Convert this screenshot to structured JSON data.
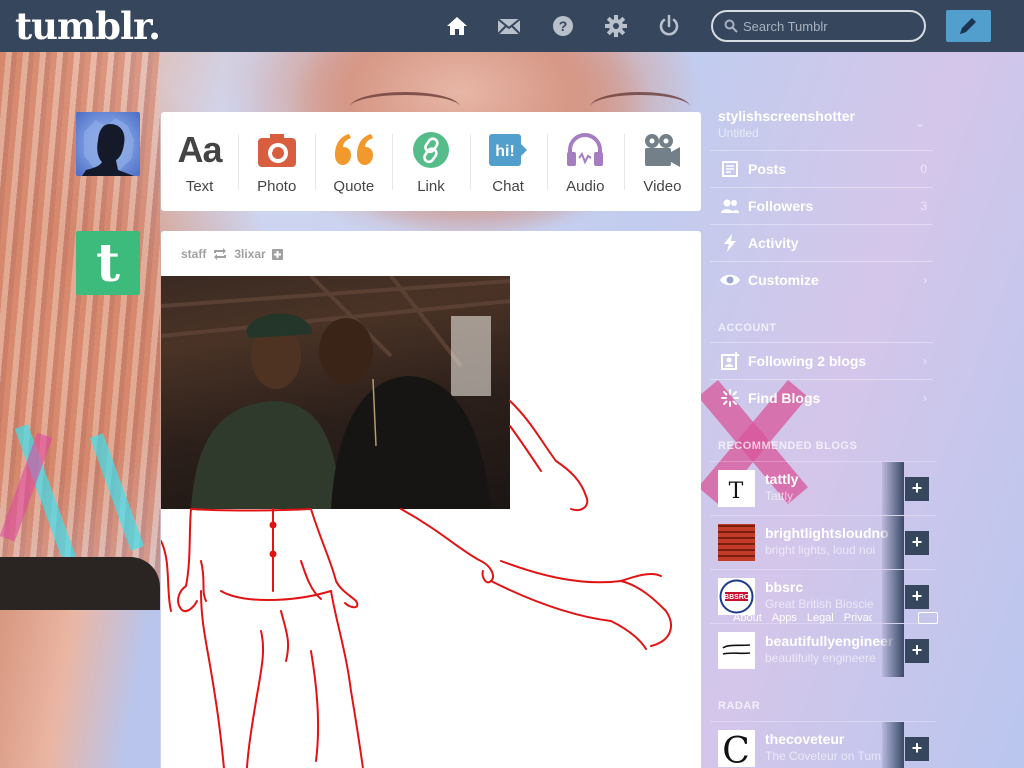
{
  "header": {
    "logo": "tumblr.",
    "search_placeholder": "Search Tumblr",
    "nav": [
      "home-icon",
      "mail-icon",
      "help-icon",
      "gear-icon",
      "power-icon"
    ],
    "compose_icon": "pencil-icon"
  },
  "post_types": [
    {
      "label": "Text",
      "icon": "text-icon",
      "color": "#444444"
    },
    {
      "label": "Photo",
      "icon": "camera-icon",
      "color": "#d95e40"
    },
    {
      "label": "Quote",
      "icon": "quote-icon",
      "color": "#f2992e"
    },
    {
      "label": "Link",
      "icon": "link-icon",
      "color": "#56bc8a"
    },
    {
      "label": "Chat",
      "icon": "chat-icon",
      "color": "#529ecc"
    },
    {
      "label": "Audio",
      "icon": "headphones-icon",
      "color": "#a77dc2"
    },
    {
      "label": "Video",
      "icon": "video-camera-icon",
      "color": "#748089"
    }
  ],
  "post": {
    "author": "staff",
    "reblogged_from": "3lixar"
  },
  "sidebar": {
    "blog_name": "stylishscreenshotter",
    "blog_subtitle": "Untitled",
    "rows": [
      {
        "label": "Posts",
        "count": "0",
        "icon": "posts-icon"
      },
      {
        "label": "Followers",
        "count": "3",
        "icon": "followers-icon"
      },
      {
        "label": "Activity",
        "count": "",
        "icon": "activity-icon"
      },
      {
        "label": "Customize",
        "count": "›",
        "icon": "eye-icon"
      }
    ],
    "account_heading": "ACCOUNT",
    "account_rows": [
      {
        "label": "Following 2 blogs",
        "count": "›",
        "icon": "following-icon"
      },
      {
        "label": "Find Blogs",
        "count": "›",
        "icon": "find-blogs-icon"
      }
    ],
    "recommended_heading": "RECOMMENDED BLOGS",
    "recommended": [
      {
        "name": "tattly",
        "subtitle": "Tattly"
      },
      {
        "name": "brightlightsloudno",
        "subtitle": "bright lights, loud noi"
      },
      {
        "name": "bbsrc",
        "subtitle": "Great British Bioscie"
      },
      {
        "name": "beautifullyengineer",
        "subtitle": "beautifully engineere"
      }
    ],
    "radar_heading": "RADAR",
    "radar": [
      {
        "name": "thecoveteur",
        "subtitle": "The Coveteur on Tum"
      }
    ]
  },
  "footer": [
    "About",
    "Apps",
    "Legal",
    "Privacy"
  ],
  "colors": {
    "header_bg": "#36465d",
    "compose_bg": "#529ecc",
    "staff_avatar": "#3cbb7c"
  }
}
